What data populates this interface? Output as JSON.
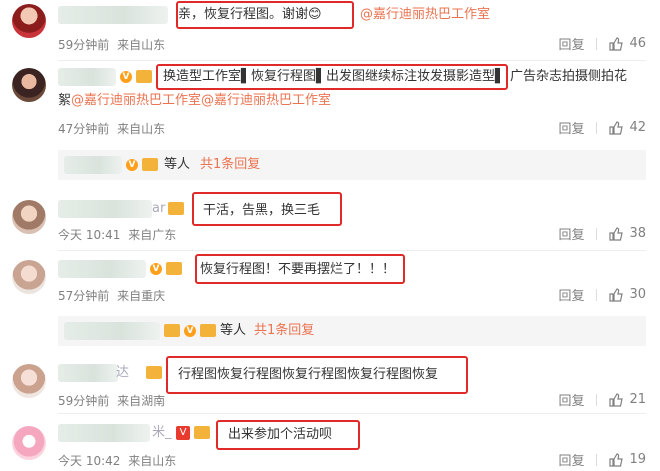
{
  "comments": [
    {
      "text_pre": "亲，恢复行程图。谢谢",
      "emoji": "😊",
      "mention": "@嘉行迪丽热巴工作室",
      "time": "59分钟前",
      "location": "来自山东",
      "reply": "回复",
      "likes": "46"
    },
    {
      "text_main": "换造型工作室▌恢复行程图▌出发图继续标注妆发摄影造型▌",
      "text_tail": "广告杂志拍摄侧拍花",
      "line2_pre": "絮",
      "mention": "@嘉行迪丽热巴工作室@嘉行迪丽热巴工作室",
      "time": "47分钟前",
      "location": "来自山东",
      "reply": "回复",
      "likes": "42",
      "sub": {
        "more": "等人",
        "link": "共1条回复"
      }
    },
    {
      "name_tail": "ar",
      "text": "干活，告黑，换三毛",
      "time": "今天 10:41",
      "location": "来自广东",
      "reply": "回复",
      "likes": "38"
    },
    {
      "text": "恢复行程图！不要再摆烂了！！！",
      "time": "57分钟前",
      "location": "来自重庆",
      "reply": "回复",
      "likes": "30",
      "sub": {
        "more": "等人",
        "link": "共1条回复"
      }
    },
    {
      "name_tail": "达",
      "text": "行程图恢复行程图恢复行程图恢复行程图恢复",
      "time": "59分钟前",
      "location": "来自湖南",
      "reply": "回复",
      "likes": "21"
    },
    {
      "name_tail": "米_",
      "text": "出来参加个活动呗",
      "time": "今天 10:42",
      "location": "来自山东",
      "reply": "回复",
      "likes": "19"
    }
  ],
  "icons": {
    "share": "share-icon",
    "like": "thumb-up-icon"
  },
  "colors": {
    "mention": "#eb7350",
    "highlight_box": "#e02a2a"
  }
}
